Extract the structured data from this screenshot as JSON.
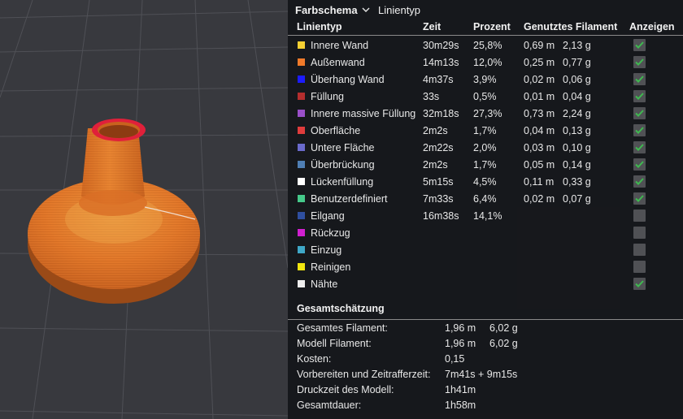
{
  "color_scheme": {
    "title": "Farbschema",
    "selected": "Linientyp"
  },
  "table": {
    "headers": {
      "type": "Linientyp",
      "time": "Zeit",
      "percent": "Prozent",
      "filament": "Genutztes Filament",
      "show": "Anzeigen"
    },
    "rows": [
      {
        "label": "Innere Wand",
        "color": "#f5d033",
        "time": "30m29s",
        "percent": "25,8%",
        "length": "0,69 m",
        "weight": "2,13 g",
        "checked": true
      },
      {
        "label": "Außenwand",
        "color": "#f07a2a",
        "time": "14m13s",
        "percent": "12,0%",
        "length": "0,25 m",
        "weight": "0,77 g",
        "checked": true
      },
      {
        "label": "Überhang Wand",
        "color": "#1c1cff",
        "time": "4m37s",
        "percent": "3,9%",
        "length": "0,02 m",
        "weight": "0,06 g",
        "checked": true
      },
      {
        "label": "Füllung",
        "color": "#b52e2e",
        "time": "33s",
        "percent": "0,5%",
        "length": "0,01 m",
        "weight": "0,04 g",
        "checked": true
      },
      {
        "label": "Innere massive Füllung",
        "color": "#9a4fc9",
        "time": "32m18s",
        "percent": "27,3%",
        "length": "0,73 m",
        "weight": "2,24 g",
        "checked": true
      },
      {
        "label": "Oberfläche",
        "color": "#e03c3c",
        "time": "2m2s",
        "percent": "1,7%",
        "length": "0,04 m",
        "weight": "0,13 g",
        "checked": true
      },
      {
        "label": "Untere Fläche",
        "color": "#6a6acc",
        "time": "2m22s",
        "percent": "2,0%",
        "length": "0,03 m",
        "weight": "0,10 g",
        "checked": true
      },
      {
        "label": "Überbrückung",
        "color": "#4f7fb5",
        "time": "2m2s",
        "percent": "1,7%",
        "length": "0,05 m",
        "weight": "0,14 g",
        "checked": true
      },
      {
        "label": "Lückenfüllung",
        "color": "#ffffff",
        "time": "5m15s",
        "percent": "4,5%",
        "length": "0,11 m",
        "weight": "0,33 g",
        "checked": true
      },
      {
        "label": "Benutzerdefiniert",
        "color": "#45c98a",
        "time": "7m33s",
        "percent": "6,4%",
        "length": "0,02 m",
        "weight": "0,07 g",
        "checked": true
      },
      {
        "label": "Eilgang",
        "color": "#2f4fa0",
        "time": "16m38s",
        "percent": "14,1%",
        "length": "",
        "weight": "",
        "checked": false
      },
      {
        "label": "Rückzug",
        "color": "#d020d0",
        "time": "",
        "percent": "",
        "length": "",
        "weight": "",
        "checked": false
      },
      {
        "label": "Einzug",
        "color": "#3fa8c8",
        "time": "",
        "percent": "",
        "length": "",
        "weight": "",
        "checked": false
      },
      {
        "label": "Reinigen",
        "color": "#f2e60f",
        "time": "",
        "percent": "",
        "length": "",
        "weight": "",
        "checked": false
      },
      {
        "label": "Nähte",
        "color": "#eeeeee",
        "time": "",
        "percent": "",
        "length": "",
        "weight": "",
        "checked": true
      }
    ]
  },
  "summary": {
    "title": "Gesamtschätzung",
    "rows": [
      {
        "label": "Gesamtes Filament:",
        "value": "1,96 m",
        "value2": "6,02 g"
      },
      {
        "label": "Modell Filament:",
        "value": "1,96 m",
        "value2": "6,02 g"
      },
      {
        "label": "Kosten:",
        "value": "0,15",
        "value2": ""
      },
      {
        "label": "Vorbereiten und Zeitrafferzeit:",
        "value": "7m41s + 9m15s",
        "value2": ""
      },
      {
        "label": "Druckzeit des Modell:",
        "value": "1h41m",
        "value2": ""
      },
      {
        "label": "Gesamtdauer:",
        "value": "1h58m",
        "value2": ""
      }
    ]
  },
  "colors": {
    "check": "#3fb950",
    "model": "#e2782a",
    "model_dark": "#b8561a",
    "seam": "#e0203a"
  },
  "icons": {
    "dropdown": "chevron-down-icon",
    "checked": "checkmark-icon"
  }
}
